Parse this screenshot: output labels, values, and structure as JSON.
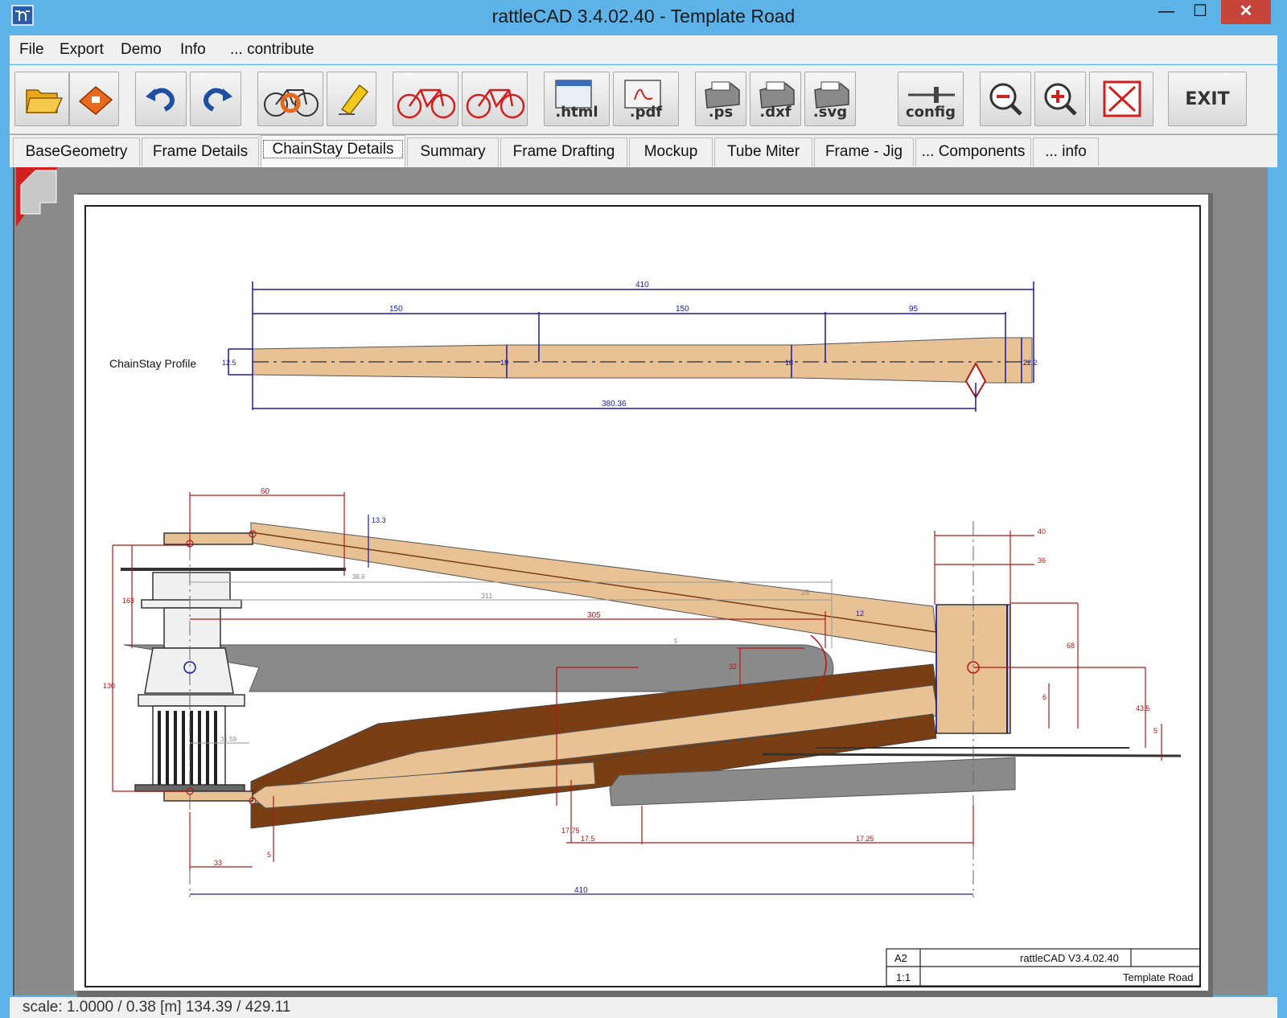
{
  "window": {
    "title": "rattleCAD  3.4.02.40 - Template Road",
    "minimize_label": "—",
    "maximize_label": "☐",
    "close_label": "✕"
  },
  "menu": {
    "items": [
      "File",
      "Export",
      "Demo",
      "Info",
      "... contribute"
    ]
  },
  "toolbar": {
    "buttons": [
      {
        "name": "open-icon",
        "label": ""
      },
      {
        "name": "save-icon",
        "label": ""
      },
      {
        "name": "undo-icon",
        "label": ""
      },
      {
        "name": "redo-icon",
        "label": ""
      },
      {
        "name": "bike-reset-icon",
        "label": ""
      },
      {
        "name": "eraser-icon",
        "label": ""
      },
      {
        "name": "bike-red-left-icon",
        "label": ""
      },
      {
        "name": "bike-red-right-icon",
        "label": ""
      },
      {
        "name": "export-html-icon",
        "label": ".html"
      },
      {
        "name": "export-pdf-icon",
        "label": ".pdf"
      },
      {
        "name": "export-ps-icon",
        "label": ".ps"
      },
      {
        "name": "export-dxf-icon",
        "label": ".dxf"
      },
      {
        "name": "export-svg-icon",
        "label": ".svg"
      },
      {
        "name": "config-icon",
        "label": "config"
      },
      {
        "name": "zoom-out-icon",
        "label": ""
      },
      {
        "name": "zoom-in-icon",
        "label": ""
      },
      {
        "name": "fit-icon",
        "label": ""
      },
      {
        "name": "exit-icon",
        "label": "EXIT"
      }
    ]
  },
  "tabs": [
    {
      "label": "BaseGeometry",
      "active": false
    },
    {
      "label": "Frame Details",
      "active": false
    },
    {
      "label": "ChainStay Details",
      "active": true
    },
    {
      "label": "Summary",
      "active": false
    },
    {
      "label": "Frame Drafting",
      "active": false
    },
    {
      "label": "Mockup",
      "active": false
    },
    {
      "label": "Tube Miter",
      "active": false
    },
    {
      "label": "Frame - Jig",
      "active": false
    },
    {
      "label": "... Components",
      "active": false
    },
    {
      "label": "... info",
      "active": false
    }
  ],
  "drawing": {
    "profile_label": "ChainStay Profile",
    "profile_dims": {
      "overall": "410",
      "seg1": "150",
      "seg2": "150",
      "seg3": "95",
      "bottom": "380.36",
      "h_left": "12.5",
      "h_mid1": "18",
      "h_mid2": "18",
      "h_right": "22.2"
    },
    "plan_dims": {
      "top_60": "60",
      "d_13_3": "13.3",
      "d_386": "38.6",
      "d_311": "311",
      "d_305": "305",
      "d_25": "25",
      "d_12": "12",
      "d_40": "40",
      "d_36": "36",
      "d_68": "68",
      "d_6": "6",
      "d_43_5": "43.5",
      "d_5_right": "5",
      "d_5_mid": "5",
      "d_163": "163",
      "d_130": "130",
      "d_32": "32",
      "d_175": "175",
      "d_3159": "31.59",
      "d_1775": "17.75",
      "d_175b": "17.5",
      "d_1725": "17.25",
      "d_33": "33",
      "d_5_bottom": "5",
      "bottom_410": "410"
    },
    "title_block": {
      "sheet": "A2",
      "version": "rattleCAD  V3.4.02.40",
      "scale": "1:1",
      "template": "Template Road"
    }
  },
  "statusbar": {
    "text": "scale: 1.0000 / 0.38  [m]  134.39 / 429.11"
  },
  "colors": {
    "titlebar": "#5db3e8",
    "tube_light": "#e8c294",
    "tube_dark": "#7a3e14",
    "gray_part": "#8a8a8a",
    "dim_blue": "#1a1aa0",
    "dim_red": "#b01818"
  }
}
